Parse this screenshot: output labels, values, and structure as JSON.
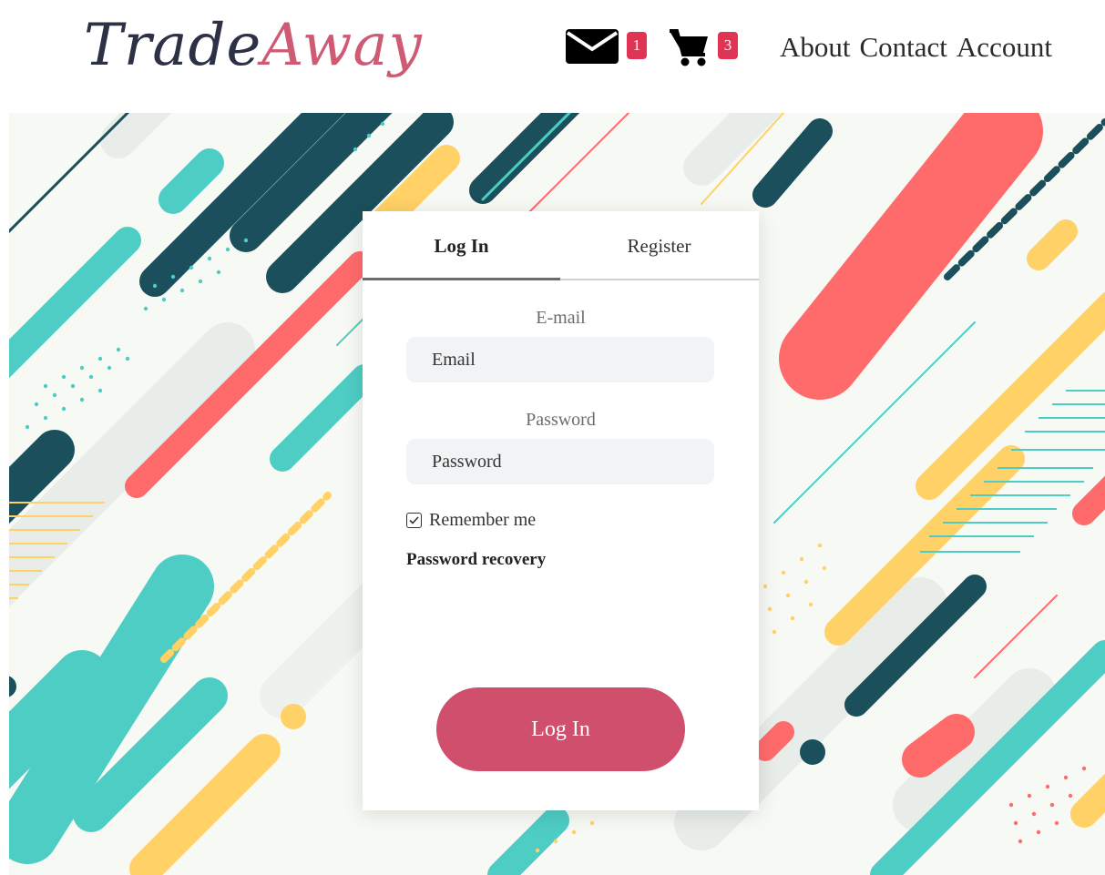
{
  "brand": {
    "part1": "Trade",
    "part2": "Away"
  },
  "header": {
    "mail_count": "1",
    "cart_count": "3",
    "nav": {
      "about": "About",
      "contact": "Contact",
      "account": "Account"
    }
  },
  "login": {
    "tab_login": "Log In",
    "tab_register": "Register",
    "email_label": "E-mail",
    "email_placeholder": "Email",
    "password_label": "Password",
    "password_placeholder": "Password",
    "remember_label": "Remember me",
    "remember_checked": true,
    "recovery_link": "Password recovery",
    "submit_label": "Log In"
  },
  "icons": {
    "mail": "envelope-icon",
    "cart": "shopping-cart-icon",
    "check": "check-icon"
  },
  "colors": {
    "brand_dark": "#2c3145",
    "brand_accent": "#cf5a74",
    "badge": "#e03455",
    "button": "#cf4f6c",
    "teal": "#4ecdc4",
    "navy": "#1b4f5c",
    "coral": "#ff6b6b",
    "yellow": "#ffd166"
  }
}
